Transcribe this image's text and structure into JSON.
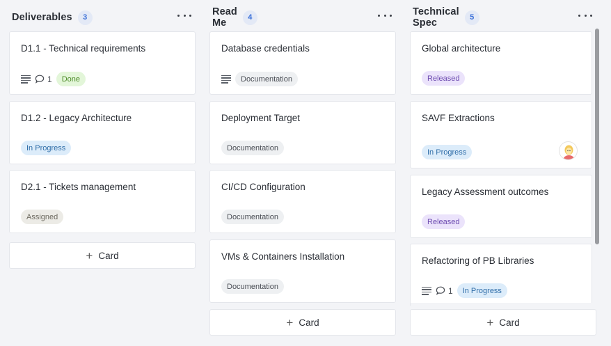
{
  "columns": [
    {
      "title": "Deliverables",
      "count": "3",
      "cards": [
        {
          "title": "D1.1 - Technical requirements",
          "comments": "1",
          "badge": "Done"
        },
        {
          "title": "D1.2 - Legacy Architecture",
          "badge": "In Progress"
        },
        {
          "title": "D2.1 - Tickets management",
          "badge": "Assigned"
        }
      ],
      "add_label": "Card"
    },
    {
      "title": "Read Me",
      "count": "4",
      "cards": [
        {
          "title": "Database credentials",
          "badge": "Documentation"
        },
        {
          "title": "Deployment Target",
          "badge": "Documentation"
        },
        {
          "title": "CI/CD Configuration",
          "badge": "Documentation"
        },
        {
          "title": "VMs & Containers Installation",
          "badge": "Documentation"
        }
      ],
      "add_label": "Card"
    },
    {
      "title": "Technical Spec",
      "count": "5",
      "cards": [
        {
          "title": "Global architecture",
          "badge": "Released"
        },
        {
          "title": "SAVF Extractions",
          "badge": "In Progress"
        },
        {
          "title": "Legacy Assessment outcomes",
          "badge": "Released"
        },
        {
          "title": "Refactoring of PB Libraries",
          "comments": "1",
          "badge": "In Progress"
        }
      ],
      "add_label": "Card"
    }
  ],
  "colors": {
    "background": "#f3f4f7",
    "count_badge": "#3a6fd8",
    "done": "#4d8b28",
    "in_progress": "#2f6da8",
    "released": "#6d4bb0"
  }
}
